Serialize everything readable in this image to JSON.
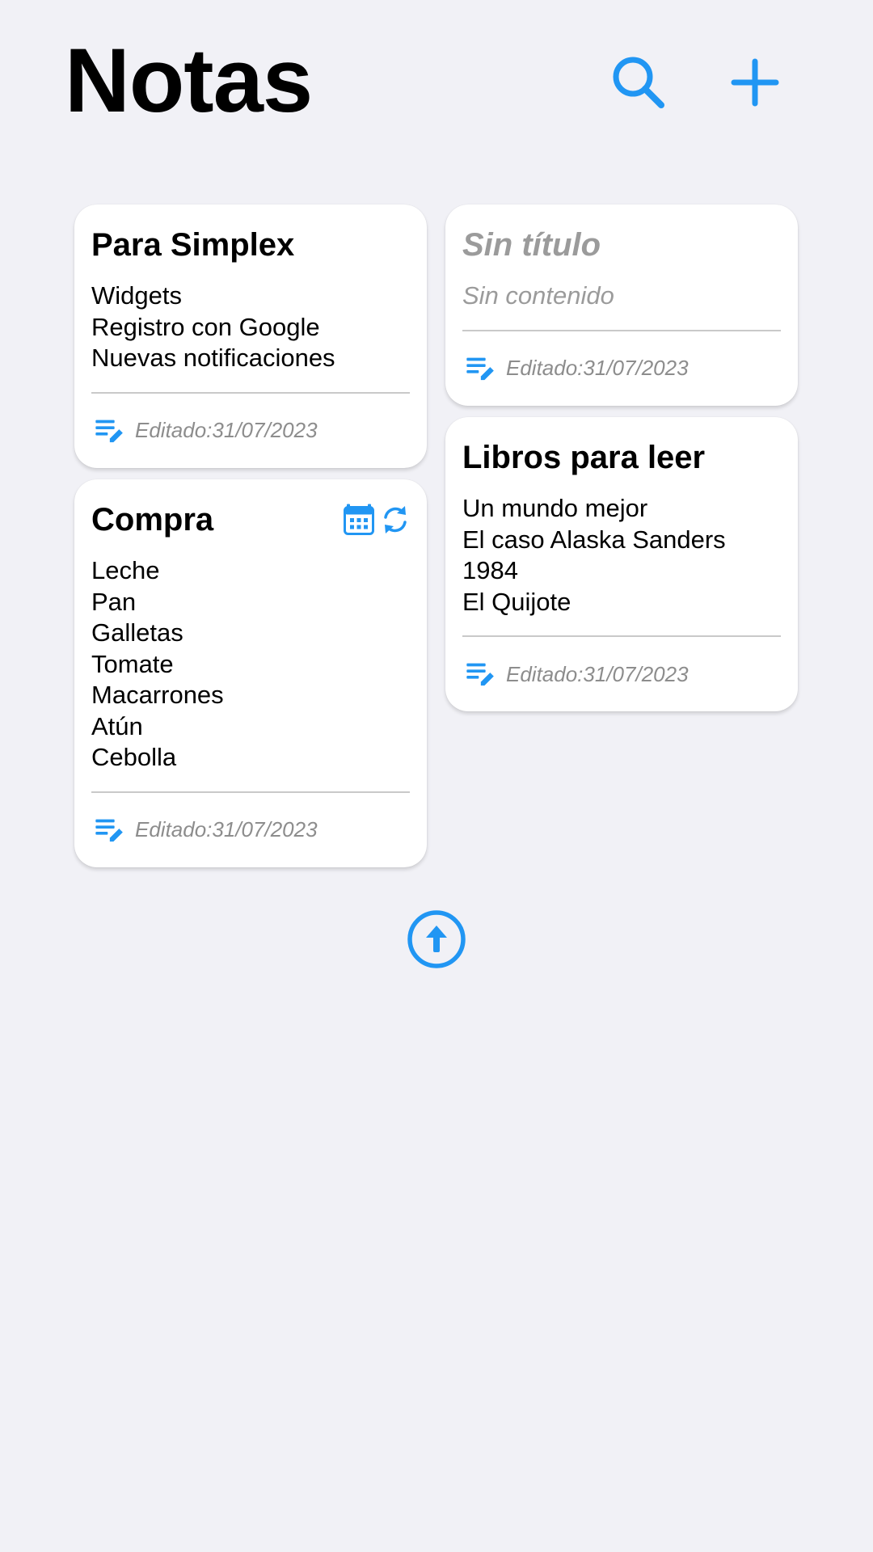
{
  "header": {
    "title": "Notas",
    "search_icon": "search-icon",
    "add_icon": "plus-icon"
  },
  "colors": {
    "accent": "#2196f3",
    "background": "#f1f1f6",
    "muted_text": "#8d8d8d"
  },
  "notes": [
    {
      "title": "Para Simplex",
      "lines": [
        "Widgets",
        "Registro con Google",
        "Nuevas notificaciones"
      ],
      "edited": "Editado:31/07/2023"
    },
    {
      "title": "Sin título",
      "lines": [
        "Sin contenido"
      ],
      "edited": "Editado:31/07/2023",
      "placeholder": true
    },
    {
      "title": "Libros para leer",
      "lines": [
        "Un mundo mejor",
        "El caso Alaska Sanders",
        "1984",
        "El Quijote"
      ],
      "edited": "Editado:31/07/2023"
    },
    {
      "title": "Compra",
      "lines": [
        "Leche",
        "Pan",
        "Galletas",
        "Tomate",
        "Macarrones",
        "Atún",
        "Cebolla"
      ],
      "edited": "Editado:31/07/2023",
      "badges": [
        "calendar-icon",
        "repeat-icon"
      ]
    }
  ],
  "footer": {
    "scroll_top_icon": "arrow-up-circle-icon"
  }
}
